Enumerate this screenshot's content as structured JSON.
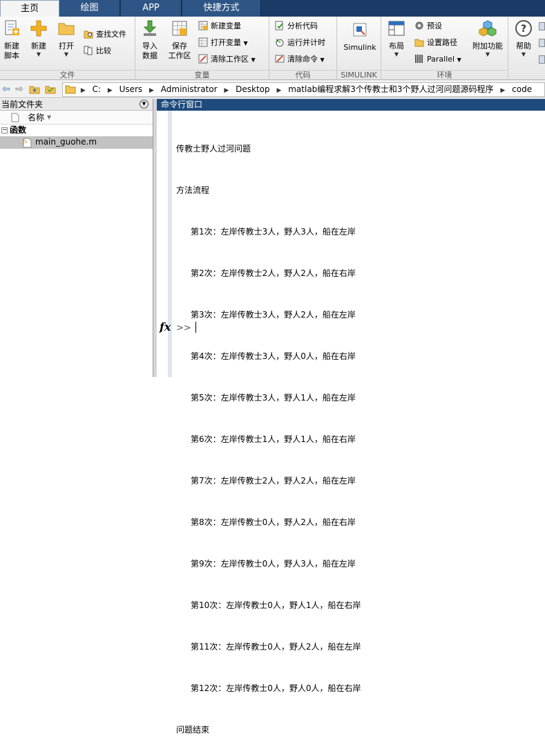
{
  "tabs": [
    "主页",
    "绘图",
    "APP",
    "快捷方式"
  ],
  "ribbon": {
    "file": {
      "label": "文件",
      "new_script": [
        "新建",
        "脚本"
      ],
      "new": "新建",
      "open": "打开",
      "find_files": "查找文件",
      "compare": "比较"
    },
    "variable": {
      "label": "变量",
      "import": [
        "导入",
        "数据"
      ],
      "save_ws": [
        "保存",
        "工作区"
      ],
      "new_var": "新建变量",
      "open_var": "打开变量",
      "clear_ws": "清除工作区"
    },
    "code": {
      "label": "代码",
      "analyze": "分析代码",
      "run_time": "运行并计时",
      "clear_cmd": "清除命令"
    },
    "simulink": {
      "label": "SIMULINK",
      "btn": "Simulink"
    },
    "env": {
      "label": "环境",
      "layout": "布局",
      "prefs": "预设",
      "set_path": "设置路径",
      "parallel": "Parallel",
      "addons": "附加功能"
    },
    "help": "帮助"
  },
  "path": [
    "C:",
    "Users",
    "Administrator",
    "Desktop",
    "matlab编程求解3个传教士和3个野人过河问题源码程序",
    "code"
  ],
  "file_panel": {
    "title": "当前文件夹",
    "col_name": "名称",
    "group": "函数",
    "file": "main_guohe.m"
  },
  "command_window": {
    "title": "命令行窗口",
    "heading": "传教士野人过河问题",
    "flow_label": "方法流程",
    "steps": [
      "第1次：左岸传教士3人，野人3人，船在左岸",
      "第2次：左岸传教士2人，野人2人，船在右岸",
      "第3次：左岸传教士3人，野人2人，船在左岸",
      "第4次：左岸传教士3人，野人0人，船在右岸",
      "第5次：左岸传教士3人，野人1人，船在左岸",
      "第6次：左岸传教士1人，野人1人，船在右岸",
      "第7次：左岸传教士2人，野人2人，船在左岸",
      "第8次：左岸传教士0人，野人2人，船在右岸",
      "第9次：左岸传教士0人，野人3人，船在左岸",
      "第10次：左岸传教士0人，野人1人，船在右岸",
      "第11次：左岸传教士0人，野人2人，船在左岸",
      "第12次：左岸传教士0人，野人0人，船在右岸"
    ],
    "end": "问题结束",
    "prompt": ">>",
    "fx": "fx"
  }
}
